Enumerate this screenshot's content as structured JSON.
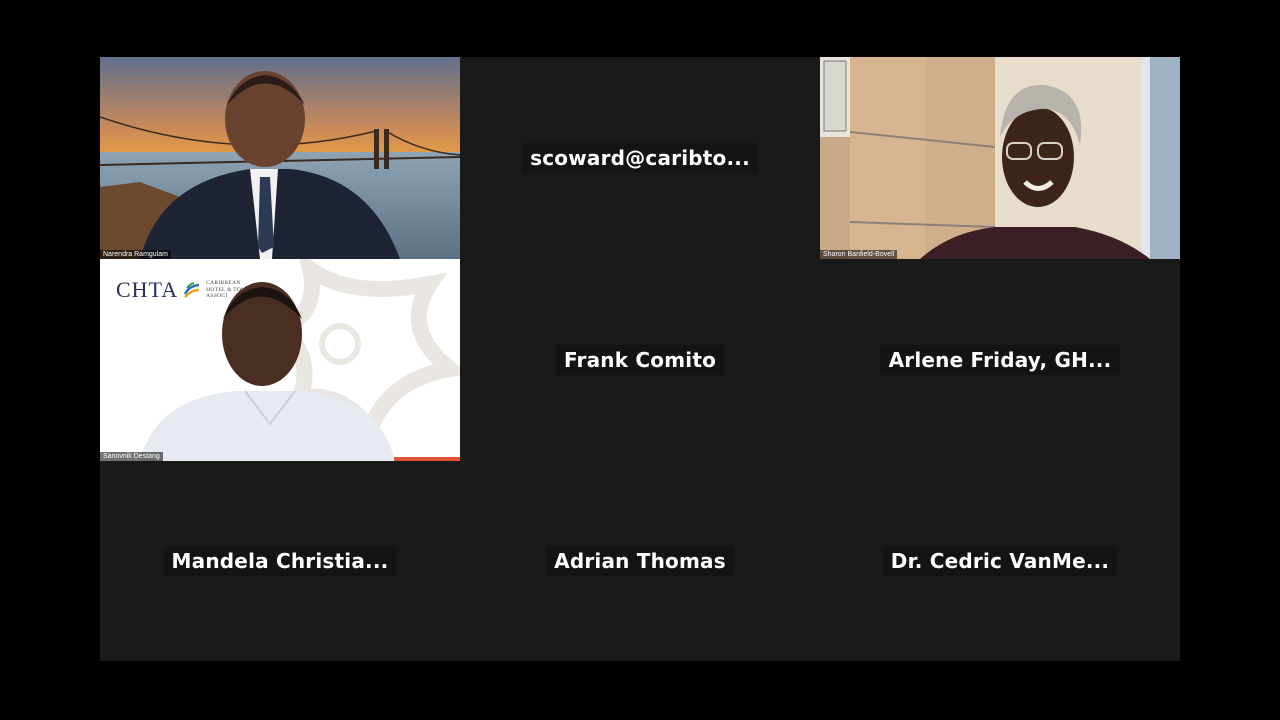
{
  "meeting": {
    "participants": [
      {
        "id": "p1",
        "name": "Narendra Ramgulam",
        "video_on": true
      },
      {
        "id": "p2",
        "name": "scoward@caribto...",
        "video_on": false
      },
      {
        "id": "p3",
        "name": "Sharon Banfield-Bovell",
        "video_on": true
      },
      {
        "id": "p4",
        "name": "Sanovnik Destang",
        "video_on": true
      },
      {
        "id": "p5",
        "name": "Frank Comito",
        "video_on": false
      },
      {
        "id": "p6",
        "name": "Arlene  Friday,  GH...",
        "video_on": false
      },
      {
        "id": "p7",
        "name": "Mandela  Christia...",
        "video_on": false
      },
      {
        "id": "p8",
        "name": "Adrian Thomas",
        "video_on": false
      },
      {
        "id": "p9",
        "name": "Dr.  Cedric  VanMe...",
        "video_on": false
      }
    ],
    "background_logo": {
      "title": "CHTA",
      "subtitle_lines": [
        "CARIBBEAN",
        "HOTEL & TOU",
        "ASSOCI"
      ]
    }
  },
  "colors": {
    "page_bg": "#000000",
    "tile_bg": "#1a1a1a",
    "name_text": "#ffffff",
    "logo_navy": "#2b2f55",
    "accent_red": "#e2553a"
  }
}
